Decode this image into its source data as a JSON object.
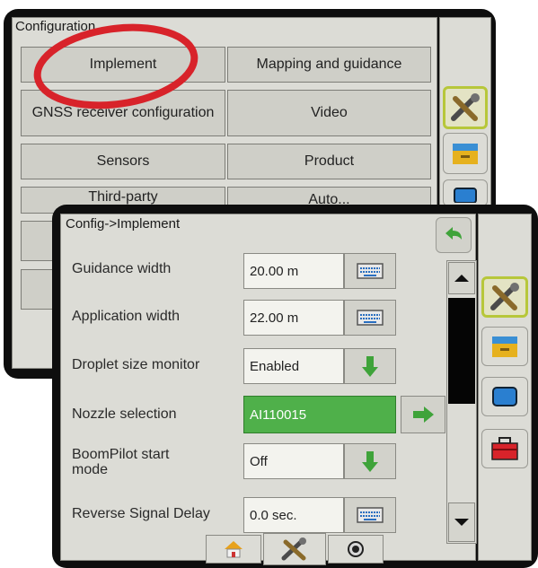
{
  "config_screen": {
    "title": "Configuration",
    "buttons": [
      {
        "label": "Implement"
      },
      {
        "label": "Mapping and guidance"
      },
      {
        "label": "GNSS receiver configuration"
      },
      {
        "label": "Video"
      },
      {
        "label": "Sensors"
      },
      {
        "label": "Product"
      },
      {
        "label": "Third-party"
      },
      {
        "label": "Auto..."
      }
    ]
  },
  "implement_screen": {
    "title": "Config->Implement",
    "rows": [
      {
        "label": "Guidance width",
        "value": "20.00 m",
        "action": "keyboard-icon"
      },
      {
        "label": "Application width",
        "value": "22.00 m",
        "action": "keyboard-icon"
      },
      {
        "label": "Droplet size monitor",
        "value": "Enabled",
        "action": "arrow-down-icon"
      },
      {
        "label": "Nozzle selection",
        "value": "AI110015",
        "action": "arrow-right-icon"
      },
      {
        "label": "BoomPilot start mode",
        "value": "Off",
        "action": "arrow-down-icon"
      },
      {
        "label": "Reverse Signal Delay",
        "value": "0.0 sec.",
        "action": "keyboard-icon"
      }
    ]
  },
  "side_icons": [
    "tools-icon",
    "folder-icon",
    "monitor-icon",
    "toolbox-icon"
  ],
  "bottom_tabs": [
    "home-icon",
    "tools-icon",
    "camera-icon"
  ],
  "colors": {
    "highlight_ring": "#d8232a",
    "nozzle_green": "#4fb04a",
    "selected_border": "#b7c73a"
  }
}
